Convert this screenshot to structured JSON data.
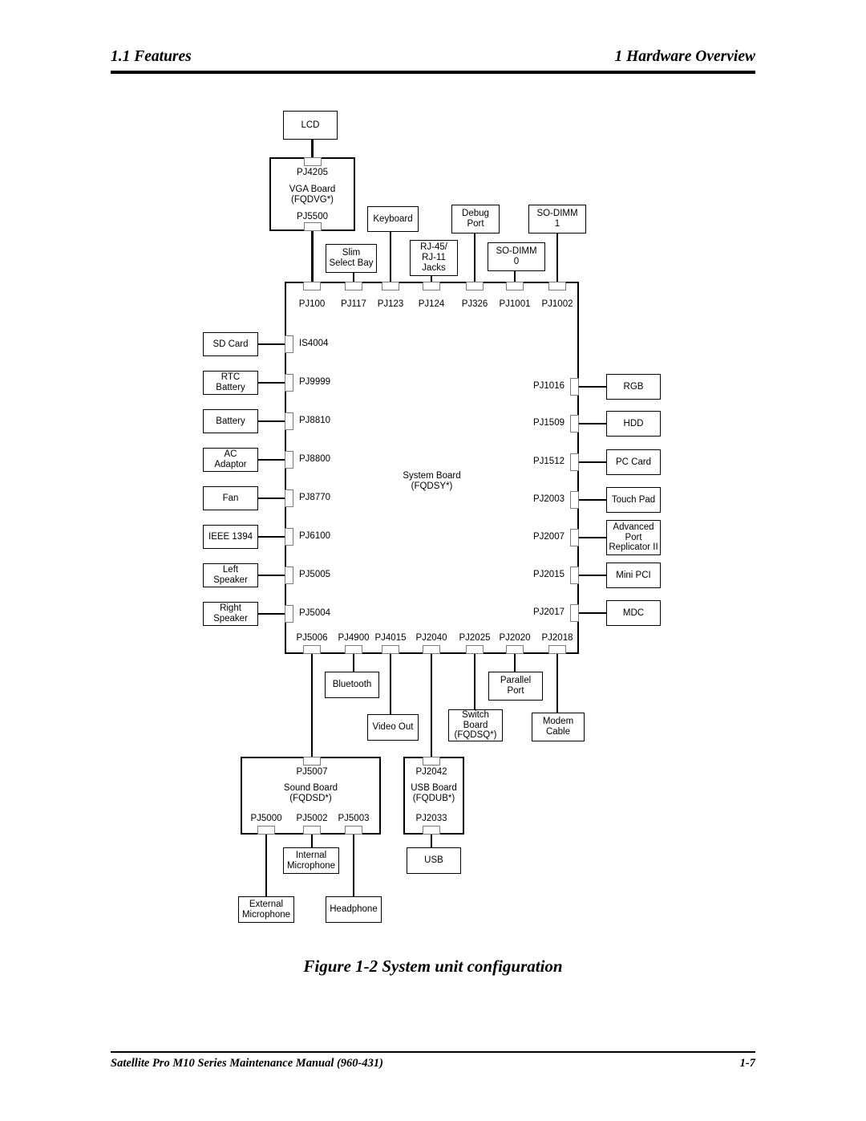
{
  "header": {
    "left": "1.1 Features",
    "right": "1 Hardware Overview"
  },
  "figure": {
    "caption": "Figure 1-2  System unit configuration"
  },
  "footer": {
    "left": "Satellite Pro M10 Series Maintenance Manual (960-431)",
    "right": "1-7"
  },
  "diagram": {
    "title": "System unit configuration",
    "boards": {
      "vga": {
        "name": "VGA Board",
        "part": "(FQDVG*)",
        "top_connector": "PJ4205",
        "bottom_connector": "PJ5500"
      },
      "system": {
        "name": "System Board",
        "part": "(FQDSY*)"
      },
      "sound": {
        "name": "Sound Board",
        "part": "(FQDSD*)",
        "top_connector": "PJ5007",
        "bottom_connectors": [
          "PJ5000",
          "PJ5002",
          "PJ5003"
        ]
      },
      "usb": {
        "name": "USB Board",
        "part": "(FQDUB*)",
        "top_connector": "PJ2042",
        "bottom_connector": "PJ2033"
      },
      "switch": {
        "name": "Switch Board",
        "part": "(FQDSQ*)"
      }
    },
    "top_devices": [
      {
        "label": "LCD"
      },
      {
        "label": "Keyboard"
      },
      {
        "label": "Slim\nSelect Bay"
      },
      {
        "label": "RJ-45/\nRJ-11\nJacks"
      },
      {
        "label": "Debug\nPort"
      },
      {
        "label": "SO-DIMM\n0"
      },
      {
        "label": "SO-DIMM\n1"
      }
    ],
    "top_connectors": [
      "PJ100",
      "PJ117",
      "PJ123",
      "PJ124",
      "PJ326",
      "PJ1001",
      "PJ1002"
    ],
    "left_devices": [
      {
        "label": "SD Card",
        "connector": "IS4004"
      },
      {
        "label": "RTC\nBattery",
        "connector": "PJ9999"
      },
      {
        "label": "Battery",
        "connector": "PJ8810"
      },
      {
        "label": "AC\nAdaptor",
        "connector": "PJ8800"
      },
      {
        "label": "Fan",
        "connector": "PJ8770"
      },
      {
        "label": "IEEE 1394",
        "connector": "PJ6100"
      },
      {
        "label": "Left\nSpeaker",
        "connector": "PJ5005"
      },
      {
        "label": "Right\nSpeaker",
        "connector": "PJ5004"
      }
    ],
    "right_devices": [
      {
        "label": "RGB",
        "connector": "PJ1016"
      },
      {
        "label": "HDD",
        "connector": "PJ1509"
      },
      {
        "label": "PC Card",
        "connector": "PJ1512"
      },
      {
        "label": "Touch Pad",
        "connector": "PJ2003"
      },
      {
        "label": "Advanced\nPort\nReplicator II",
        "connector": "PJ2007"
      },
      {
        "label": "Mini PCI",
        "connector": "PJ2015"
      },
      {
        "label": "MDC",
        "connector": "PJ2017"
      }
    ],
    "bottom_connectors": [
      "PJ5006",
      "PJ4900",
      "PJ4015",
      "PJ2040",
      "PJ2025",
      "PJ2020",
      "PJ2018"
    ],
    "bottom_devices": [
      {
        "label": "Bluetooth"
      },
      {
        "label": "Video Out"
      },
      {
        "label": "Parallel\nPort"
      },
      {
        "label": "Modem\nCable"
      }
    ],
    "sound_devices": [
      {
        "label": "External\nMicrophone"
      },
      {
        "label": "Internal\nMicrophone"
      },
      {
        "label": "Headphone"
      }
    ],
    "usb_devices": [
      {
        "label": "USB"
      }
    ]
  }
}
